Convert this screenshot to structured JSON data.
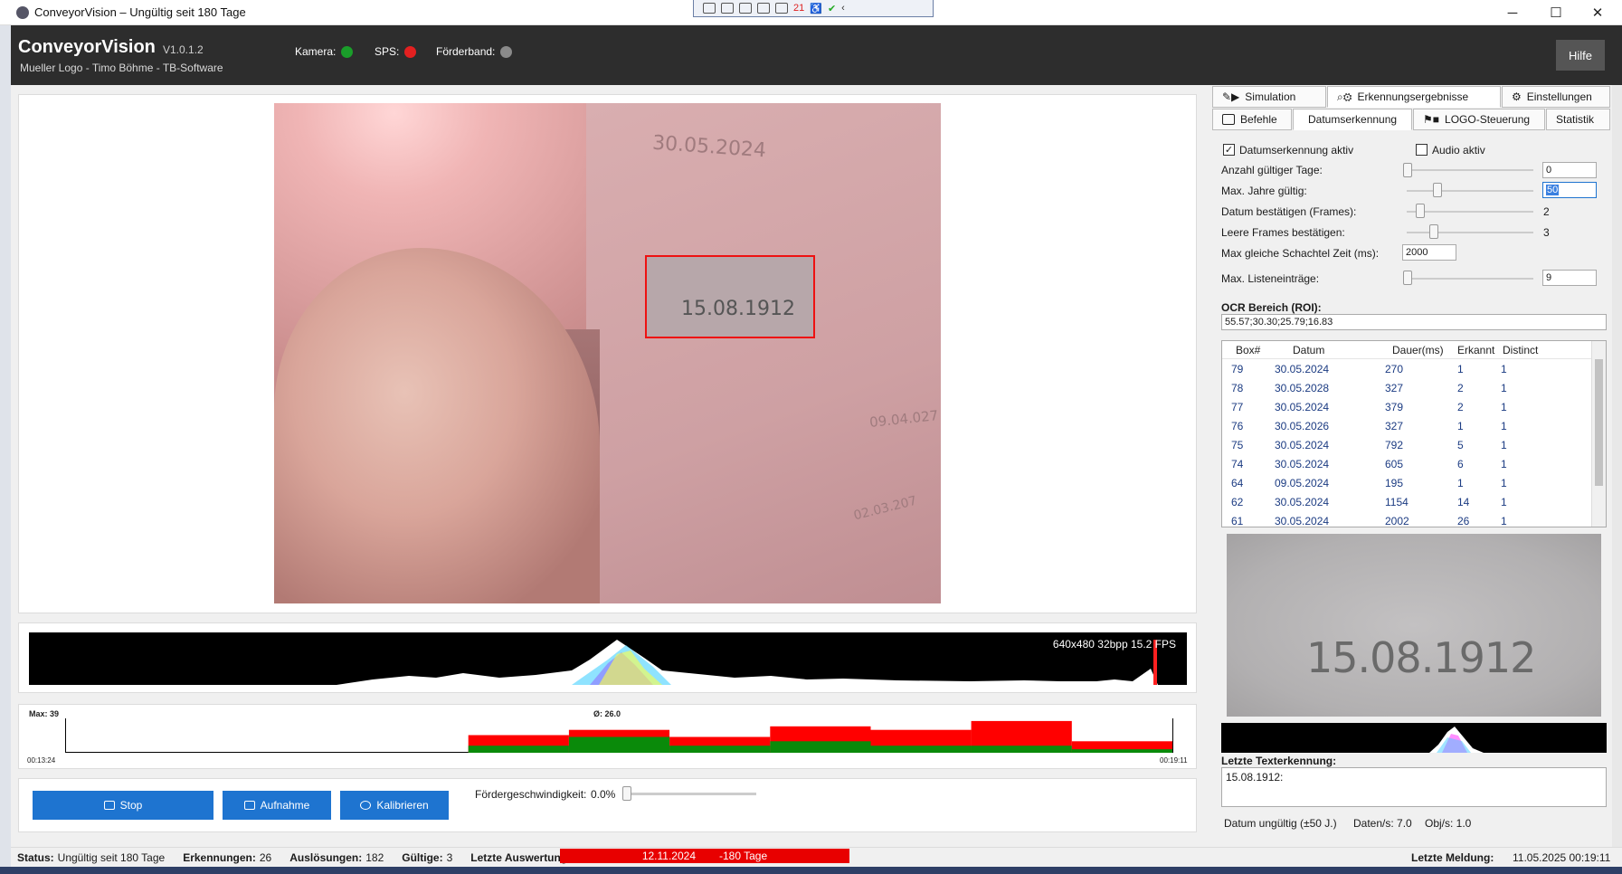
{
  "window": {
    "title": "ConveyorVision – Ungültig seit 180 Tage",
    "toolbar_badge": "21"
  },
  "header": {
    "app_name": "ConveyorVision",
    "version": "V1.0.1.2",
    "subtitle": "Mueller Logo - Timo Böhme - TB-Software",
    "indicators": [
      {
        "label": "Kamera:",
        "color": "#1a9e2a"
      },
      {
        "label": "SPS:",
        "color": "#e32020"
      },
      {
        "label": "Förderband:",
        "color": "#8a8a8a"
      }
    ],
    "help_label": "Hilfe"
  },
  "camera": {
    "roi_text": "15.08.1912",
    "ghost_texts": [
      "30.05.2024",
      "09.04.027",
      "02.03.207"
    ]
  },
  "histogram": {
    "info": "640x480 32bpp   15.2 FPS"
  },
  "stats_chart": {
    "max_label": "Max: 39",
    "avg_label": "Ø: 26.0",
    "time_start": "00:13:24",
    "time_end": "00:19:11"
  },
  "chart_data": {
    "type": "bar",
    "categories": [
      "1",
      "2",
      "3",
      "4",
      "5",
      "6",
      "7",
      "8",
      "9",
      "10",
      "11"
    ],
    "ylim": [
      0,
      39
    ],
    "series": [
      {
        "values": [
          0,
          0,
          0,
          0,
          20,
          26,
          18,
          30,
          26,
          36,
          13
        ],
        "color": "#ff0000"
      },
      {
        "values": [
          0,
          0,
          0,
          0,
          8,
          18,
          8,
          13,
          8,
          8,
          4
        ],
        "color": "#0a8a0a"
      }
    ]
  },
  "controls": {
    "stop_label": "Stop",
    "record_label": "Aufnahme",
    "calibrate_label": "Kalibrieren",
    "speed_label": "Fördergeschwindigkeit:",
    "speed_value": "0.0%"
  },
  "status": {
    "status_label": "Status:",
    "status_value": "Ungültig seit 180 Tage",
    "detections_label": "Erkennungen:",
    "detections_value": "26",
    "triggers_label": "Auslösungen:",
    "triggers_value": "182",
    "valid_label": "Gültige:",
    "valid_value": "3",
    "last_eval_label": "Letzte Auswertung:",
    "last_eval_date": "12.11.2024",
    "last_eval_days": "-180 Tage",
    "last_msg_label": "Letzte Meldung:",
    "last_msg_value": "11.05.2025 00:19:11"
  },
  "tabs_top": [
    "Simulation",
    "Erkennungsergebnisse",
    "Einstellungen"
  ],
  "tabs_bottom": [
    "Befehle",
    "Datumserkennung",
    "LOGO-Steuerung",
    "Statistik"
  ],
  "settings": {
    "date_detect_label": "Datumserkennung aktiv",
    "audio_label": "Audio aktiv",
    "valid_days_label": "Anzahl gültiger Tage:",
    "valid_days_value": "0",
    "max_years_label": "Max. Jahre gültig:",
    "max_years_value": "50",
    "confirm_frames_label": "Datum bestätigen (Frames):",
    "confirm_frames_value": "2",
    "empty_frames_label": "Leere Frames bestätigen:",
    "empty_frames_value": "3",
    "same_box_label": "Max gleiche Schachtel Zeit (ms):",
    "same_box_value": "2000",
    "max_list_label": "Max. Listeneinträge:",
    "max_list_value": "9",
    "roi_label": "OCR Bereich (ROI):",
    "roi_value": "55.57;30.30;25.79;16.83"
  },
  "results_table": {
    "headers": [
      "Box#",
      "Datum",
      "Dauer(ms)",
      "Erkannt",
      "Distinct"
    ],
    "rows": [
      [
        "79",
        "30.05.2024",
        "270",
        "1",
        "1"
      ],
      [
        "78",
        "30.05.2028",
        "327",
        "2",
        "1"
      ],
      [
        "77",
        "30.05.2024",
        "379",
        "2",
        "1"
      ],
      [
        "76",
        "30.05.2026",
        "327",
        "1",
        "1"
      ],
      [
        "75",
        "30.05.2024",
        "792",
        "5",
        "1"
      ],
      [
        "74",
        "30.05.2024",
        "605",
        "6",
        "1"
      ],
      [
        "64",
        "09.05.2024",
        "195",
        "1",
        "1"
      ],
      [
        "62",
        "30.05.2024",
        "1154",
        "14",
        "1"
      ],
      [
        "61",
        "30.05.2024",
        "2002",
        "26",
        "1"
      ]
    ]
  },
  "ocr": {
    "thumb_text": "15.08.1912",
    "last_text_label": "Letzte Texterkennung:",
    "last_text_value": "15.08.1912:",
    "date_invalid": "Datum ungültig (±50 J.)",
    "data_rate": "Daten/s: 7.0",
    "obj_rate": "Obj/s: 1.0"
  }
}
